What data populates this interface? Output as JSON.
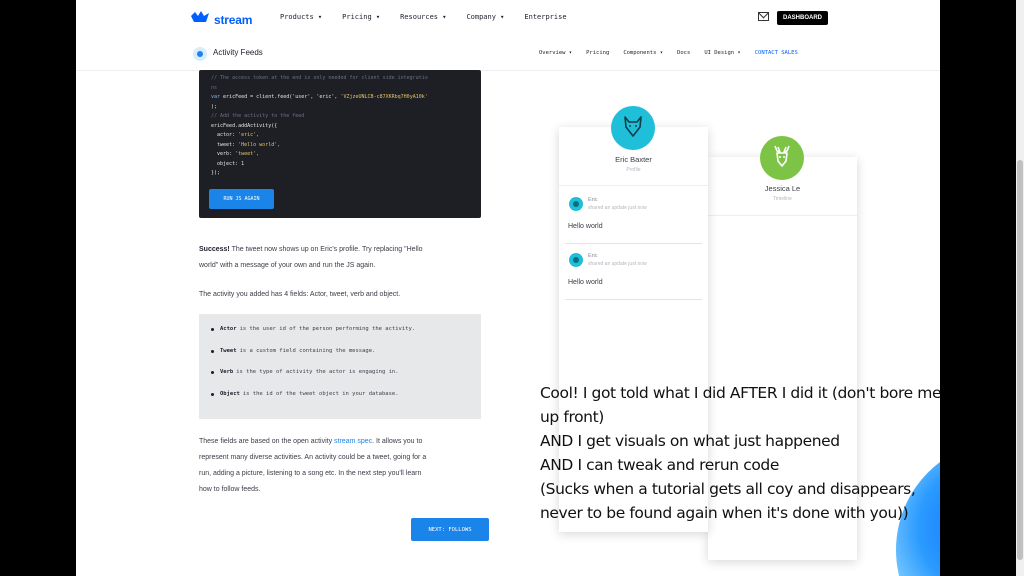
{
  "nav": {
    "logo": "stream",
    "links": [
      "Products ▾",
      "Pricing ▾",
      "Resources ▾",
      "Company ▾",
      "Enterprise"
    ],
    "dashboard": "DASHBOARD"
  },
  "subnav": {
    "product": "Activity Feeds",
    "links": [
      "Overview ▾",
      "Pricing",
      "Components ▾",
      "Docs",
      "UI Design ▾"
    ],
    "cta": "CONTACT SALES"
  },
  "code": {
    "line1": "// The access token at the end is only needed for client side integratio",
    "line2": "ns",
    "line3_kw": "var",
    "line3_rest": " ericFeed = client.feed('user', 'eric', ",
    "line3_str": "'VZjzeUNLCB-c87XKRbq7H0yA10k'",
    "line4": ");",
    "line5": "// Add the activity to the feed",
    "line6": "ericFeed.addActivity({",
    "line7_key": "  actor: ",
    "line7_val": "'eric',",
    "line8_key": "  tweet: ",
    "line8_val": "'Hello world',",
    "line9_key": "  verb: ",
    "line9_val": "'tweet',",
    "line10": "  object: 1",
    "line11": "});",
    "run_button": "RUN JS AGAIN"
  },
  "content": {
    "success_bold": "Success!",
    "success_line1": " The tweet now shows up on Eric's profile. Try replacing \"Hello",
    "success_line2": "world\" with a message of your own and run the JS again.",
    "fields_intro": "The activity you added has 4 fields: Actor, tweet, verb and object.",
    "fields": [
      {
        "name": "Actor",
        "desc": "is the user id of the person performing the activity."
      },
      {
        "name": "Tweet",
        "desc": "is a custom field containing the message."
      },
      {
        "name": "Verb",
        "desc": "is the type of activity the actor is engaging in."
      },
      {
        "name": "Object",
        "desc": "is the id of the tweet object in your database."
      }
    ],
    "para_l1_pre": "These fields are based on the open activity ",
    "para_l1_link": "stream spec",
    "para_l1_post": ". It allows you to",
    "para_l2": "represent many diverse activities. An activity could be a tweet, going for a",
    "para_l3": "run, adding a picture, listening to a song etc. In the next step you'll learn",
    "para_l4": "how to follow feeds.",
    "next_button": "NEXT: FOLLOWS"
  },
  "cards": [
    {
      "name": "Eric Baxter",
      "feed": "Profile",
      "activities": [
        {
          "actor": "Eric",
          "status": "shared an update just now",
          "text": "Hello world"
        },
        {
          "actor": "Eric",
          "status": "shared an update just now",
          "text": "Hello world"
        }
      ]
    },
    {
      "name": "Jessica Le",
      "feed": "Timeline"
    }
  ],
  "note": {
    "l1": "Cool! I got told what I did AFTER I did it (don't bore me",
    "l2": "up front)",
    "l3": "AND I get visuals on what just happened",
    "l4": "AND I can tweak and rerun code",
    "l5": "(Sucks when a tutorial gets all coy and disappears,",
    "l6": "never to be found again when it's done with you))"
  },
  "colors": {
    "brand_blue": "#005fff",
    "button_blue": "#1b84e8",
    "code_bg": "#1d1f24",
    "eric_avatar": "#1fbfd9",
    "jessica_avatar": "#7cc346"
  }
}
